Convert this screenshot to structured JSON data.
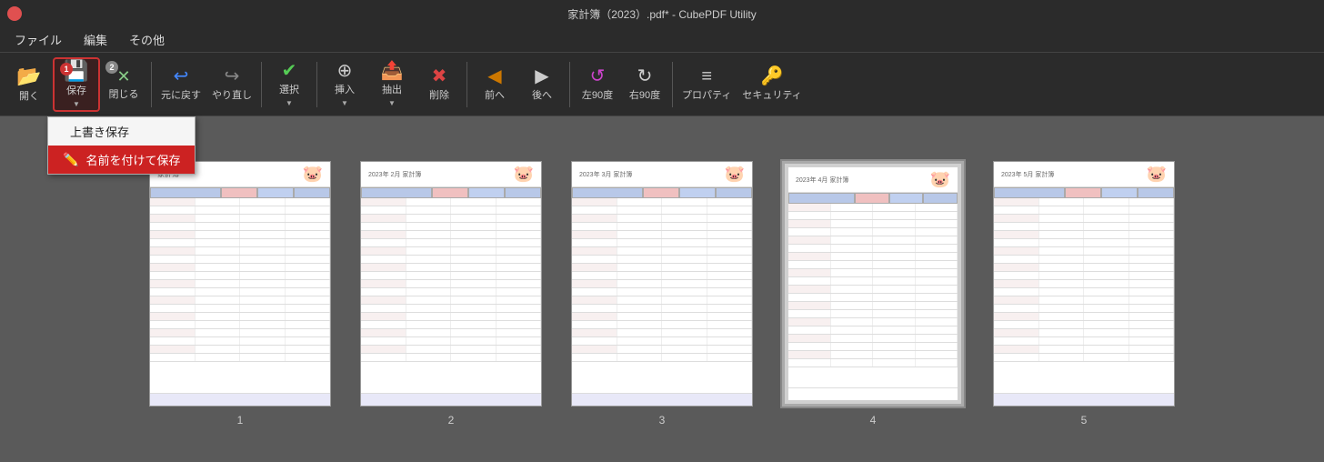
{
  "titleBar": {
    "title": "家計簿（2023）.pdf* - CubePDF Utility"
  },
  "menuBar": {
    "items": [
      {
        "label": "ファイル"
      },
      {
        "label": "編集"
      },
      {
        "label": "その他"
      }
    ]
  },
  "toolbar": {
    "buttons": [
      {
        "id": "open",
        "label": "開く",
        "icon": "📂",
        "hasDropdown": false
      },
      {
        "id": "save",
        "label": "保存",
        "icon": "💾",
        "hasDropdown": true,
        "active": true,
        "badge": "1"
      },
      {
        "id": "close",
        "label": "閉じる",
        "icon": "✕",
        "hasDropdown": false,
        "badge2": "2"
      },
      {
        "id": "undo",
        "label": "元に戻す",
        "icon": "↩",
        "hasDropdown": false
      },
      {
        "id": "redo",
        "label": "やり直し",
        "icon": "↪",
        "hasDropdown": false
      },
      {
        "id": "select",
        "label": "選択",
        "icon": "✔",
        "hasDropdown": true
      },
      {
        "id": "insert",
        "label": "挿入",
        "icon": "⊕",
        "hasDropdown": true
      },
      {
        "id": "extract",
        "label": "抽出",
        "icon": "📎",
        "hasDropdown": true
      },
      {
        "id": "delete",
        "label": "削除",
        "icon": "✖",
        "hasDropdown": false
      },
      {
        "id": "prev",
        "label": "前へ",
        "icon": "◀",
        "hasDropdown": false
      },
      {
        "id": "next",
        "label": "後へ",
        "icon": "▶",
        "hasDropdown": false
      },
      {
        "id": "rotate_left",
        "label": "左90度",
        "icon": "↺",
        "hasDropdown": false
      },
      {
        "id": "rotate_right",
        "label": "右90度",
        "icon": "↻",
        "hasDropdown": false
      },
      {
        "id": "properties",
        "label": "プロパティ",
        "icon": "≡",
        "hasDropdown": false
      },
      {
        "id": "security",
        "label": "セキュリティ",
        "icon": "🔑",
        "hasDropdown": false
      }
    ],
    "dropdown": {
      "visible": true,
      "items": [
        {
          "label": "上書き保存",
          "icon": "",
          "selected": false
        },
        {
          "label": "名前を付けて保存",
          "icon": "✏️",
          "selected": true
        }
      ]
    }
  },
  "pages": [
    {
      "number": "1",
      "title": "家計簿",
      "month": "",
      "selected": false
    },
    {
      "number": "2",
      "title": "2023年",
      "month": "2月 家計簿",
      "selected": false
    },
    {
      "number": "3",
      "title": "2023年",
      "month": "3月 家計簿",
      "selected": false
    },
    {
      "number": "4",
      "title": "2023年",
      "month": "4月 家計簿",
      "selected": true
    },
    {
      "number": "5",
      "title": "2023年",
      "month": "5月 家計簿",
      "selected": false
    }
  ]
}
